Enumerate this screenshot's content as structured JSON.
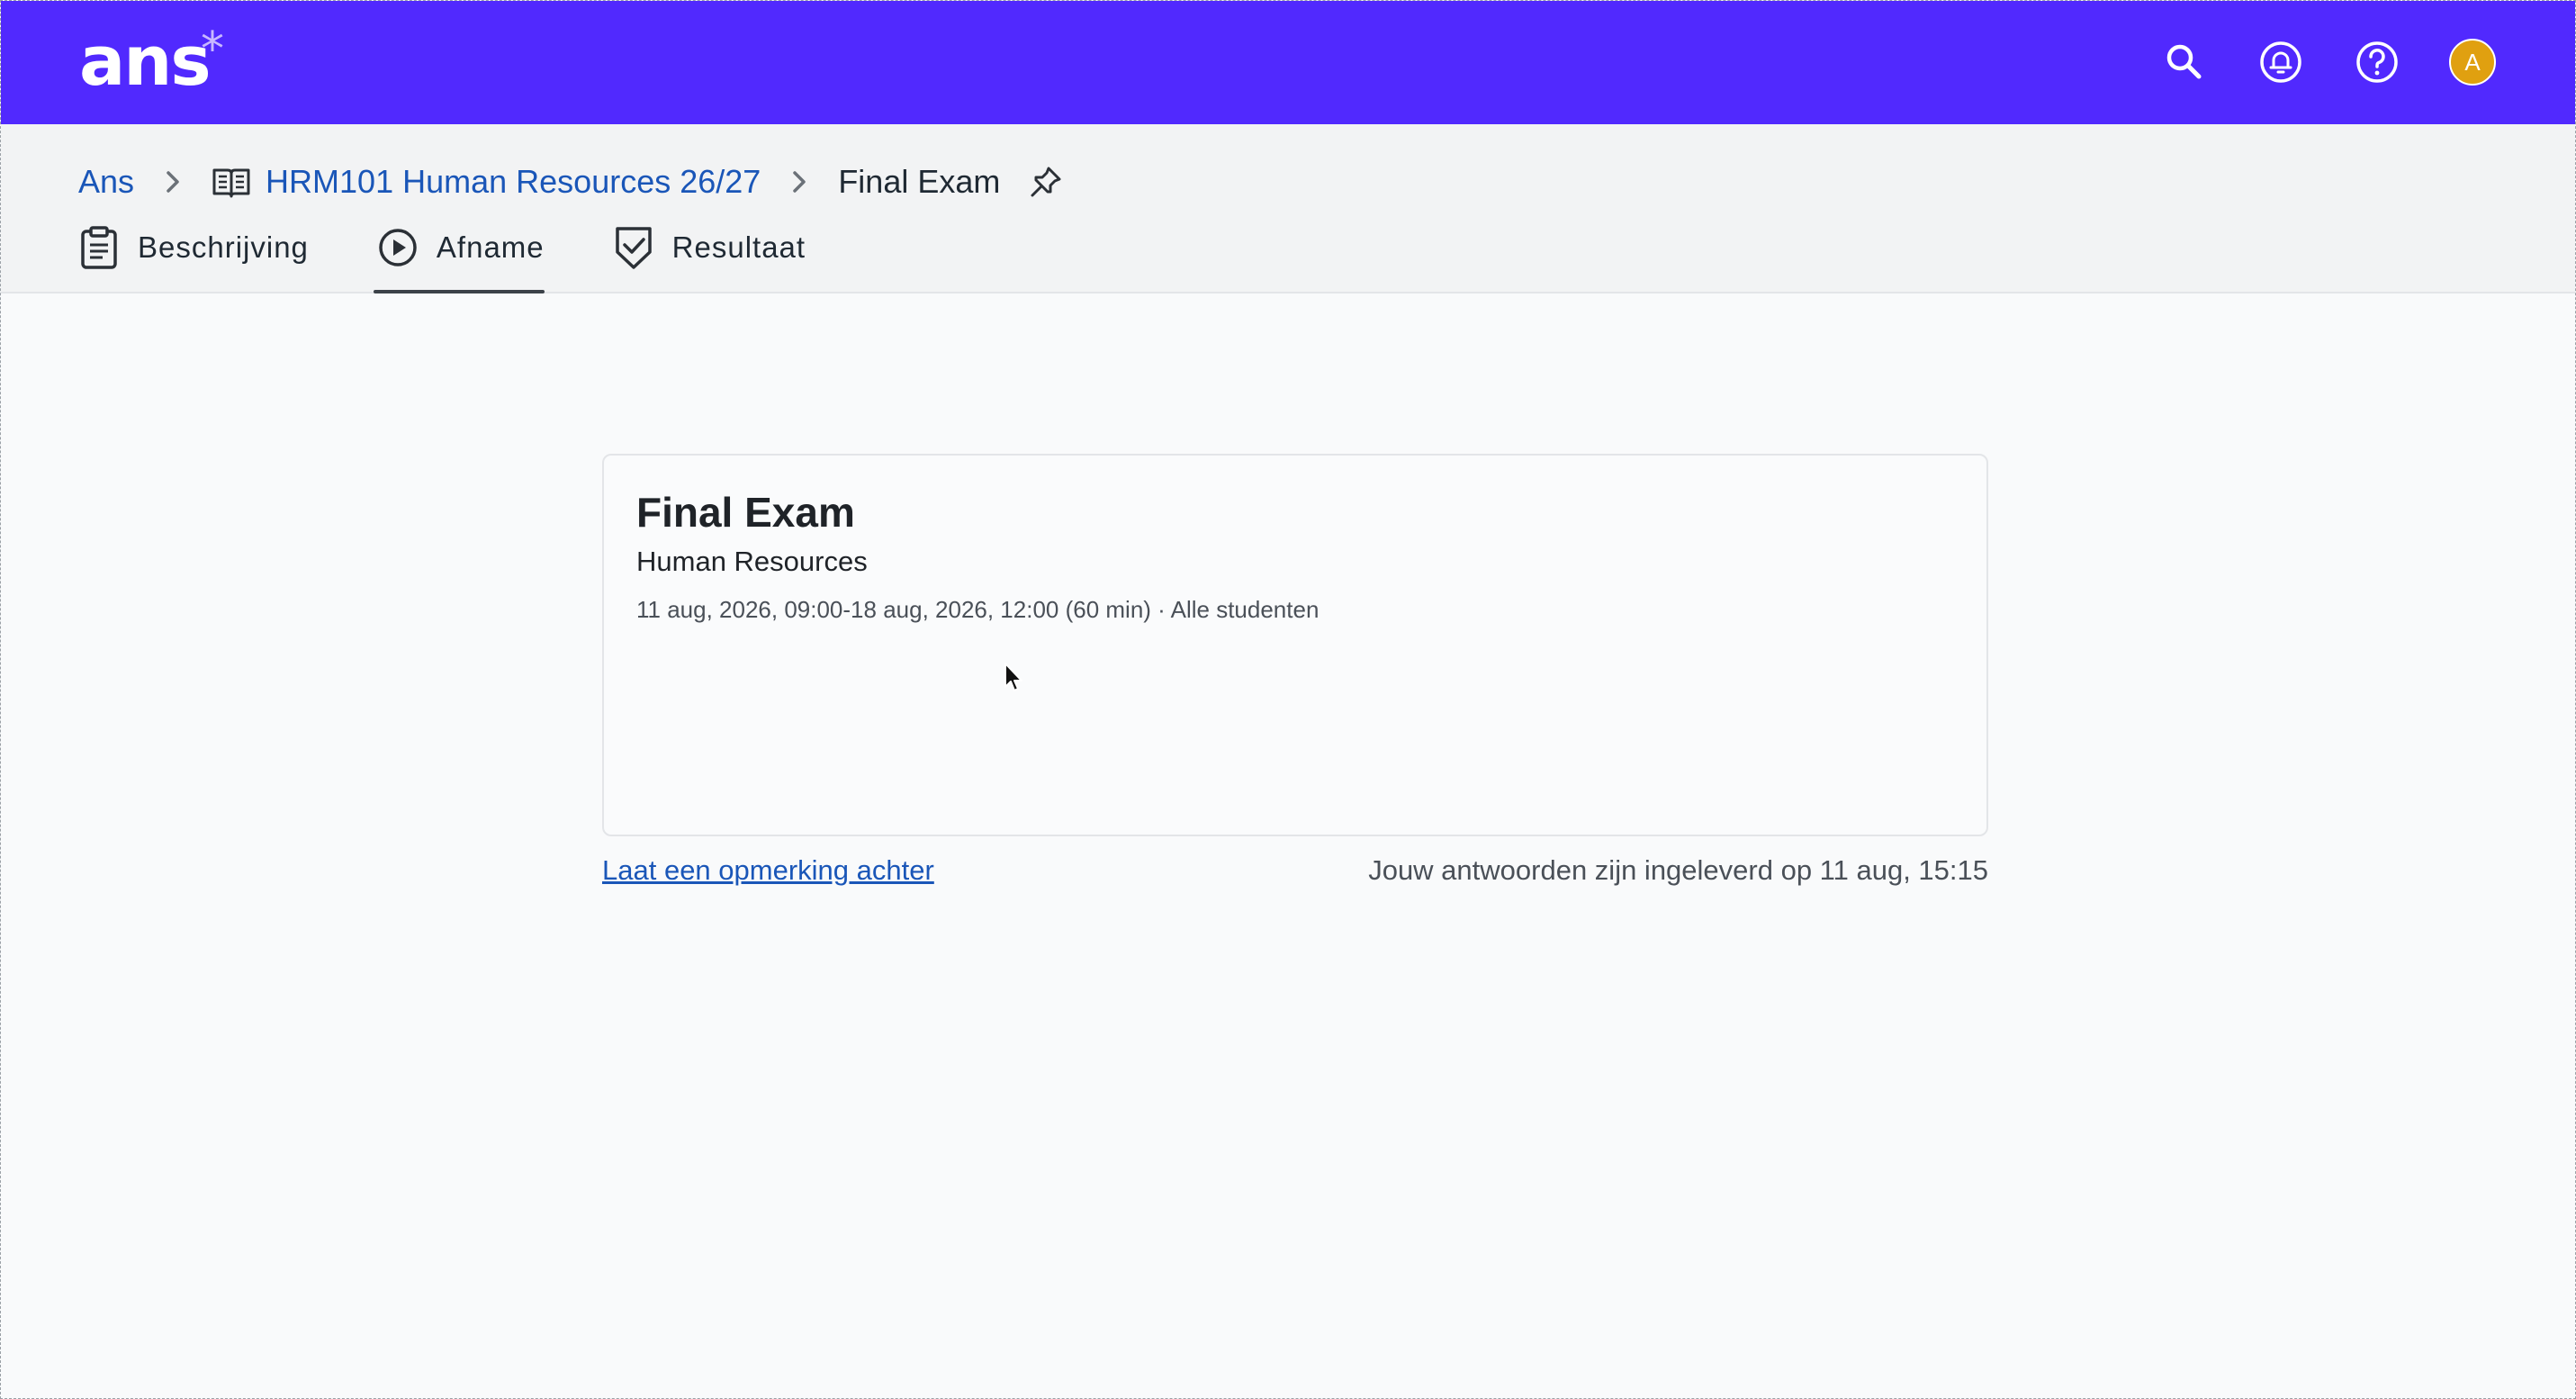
{
  "app": {
    "logo_text": "ans",
    "logo_mark": "*",
    "brand_color": "#5129fe",
    "icons": [
      "search-icon",
      "bell-icon",
      "help-icon"
    ],
    "avatar_initial": "A",
    "avatar_color": "#e0a010"
  },
  "breadcrumb": {
    "home": "Ans",
    "course_icon": "book-icon",
    "course": "HRM101 Human Resources 26/27",
    "current": "Final Exam",
    "pin_icon": "pin-icon"
  },
  "tabs": [
    {
      "label": "Beschrijving",
      "icon": "clipboard-icon",
      "active": false
    },
    {
      "label": "Afname",
      "icon": "play-circle-icon",
      "active": true
    },
    {
      "label": "Resultaat",
      "icon": "shield-check-icon",
      "active": false
    }
  ],
  "card": {
    "title": "Final Exam",
    "subtitle": "Human Resources",
    "meta": "11 aug, 2026, 09:00-18 aug, 2026, 12:00 (60 min) · Alle studenten"
  },
  "footer": {
    "comment_link": "Laat een opmerking achter",
    "status": "Jouw antwoorden zijn ingeleverd op 11 aug, 15:15"
  }
}
